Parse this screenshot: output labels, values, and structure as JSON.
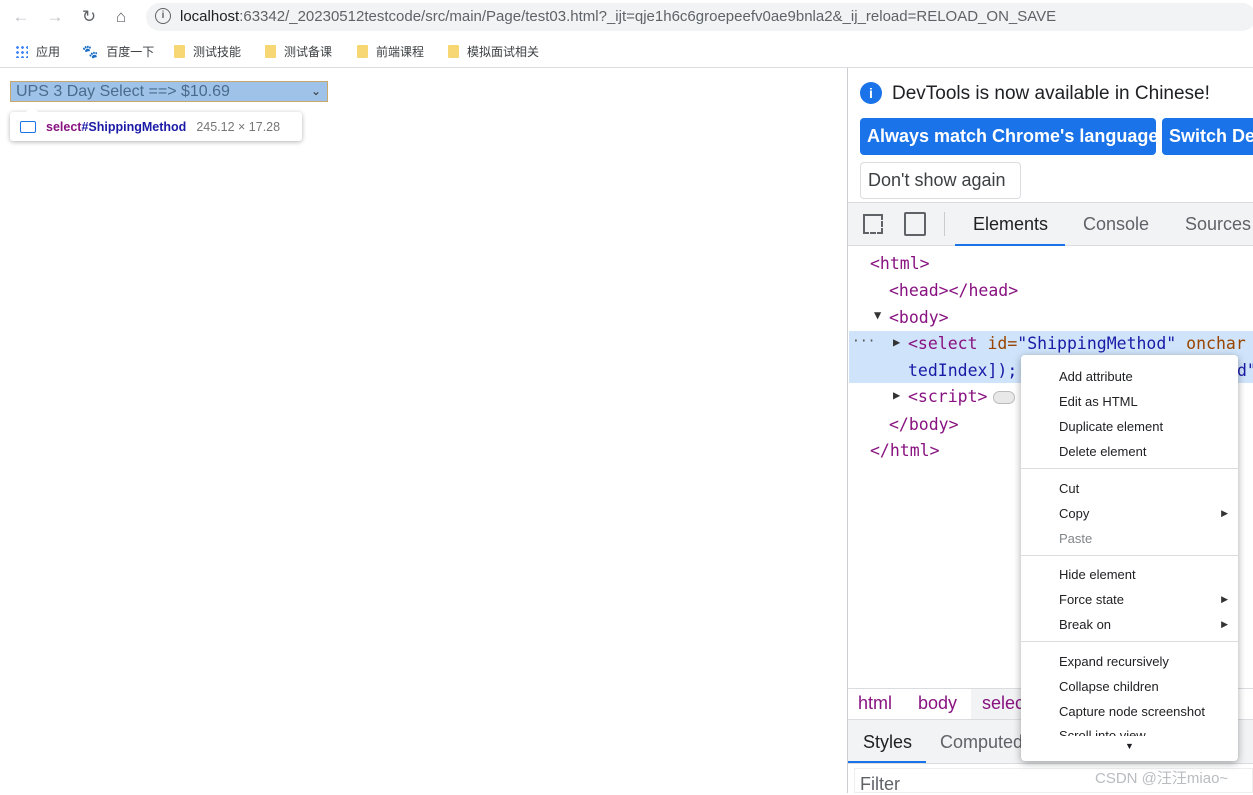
{
  "browser": {
    "url_host": "localhost",
    "url_rest": ":63342/_20230512testcode/src/main/Page/test03.html?_ijt=qje1h6c6groepeefv0ae9bnla2&_ij_reload=RELOAD_ON_SAVE",
    "bookmarks": [
      "应用",
      "百度一下",
      "测试技能",
      "测试备课",
      "前端课程",
      "模拟面试相关"
    ]
  },
  "page": {
    "select_value": "UPS 3 Day Select ==> $10.69",
    "tooltip_tag": "select",
    "tooltip_id": "#ShippingMethod",
    "tooltip_size": "245.12 × 17.28"
  },
  "devtools": {
    "infobar": {
      "message": "DevTools is now available in Chinese!",
      "btn_match": "Always match Chrome's language",
      "btn_switch": "Switch DevTools to Chinese",
      "btn_dismiss": "Don't show again"
    },
    "tabs": [
      "Elements",
      "Console",
      "Sources"
    ],
    "dom": {
      "html_open": "<html>",
      "head": "<head></head>",
      "body_open": "<body>",
      "select_tag": "<select",
      "select_attr": " id=",
      "select_val": "\"ShippingMethod\"",
      "select_attr2": " onchar",
      "select_line2": "tedIndex]);",
      "select_line2_end": "d\"",
      "script": "<script>",
      "body_close": "</body>",
      "html_close": "</html>",
      "ellipsis": "···"
    },
    "context_menu": [
      "Add attribute",
      "Edit as HTML",
      "Duplicate element",
      "Delete element",
      "Cut",
      "Copy",
      "Paste",
      "Hide element",
      "Force state",
      "Break on",
      "Expand recursively",
      "Collapse children",
      "Capture node screenshot",
      "Scroll into view"
    ],
    "breadcrumbs": [
      "html",
      "body",
      "selec"
    ],
    "styles_tabs": [
      "Styles",
      "Computed"
    ],
    "filter_placeholder": "Filter"
  },
  "watermark": "CSDN @汪汪miao~"
}
